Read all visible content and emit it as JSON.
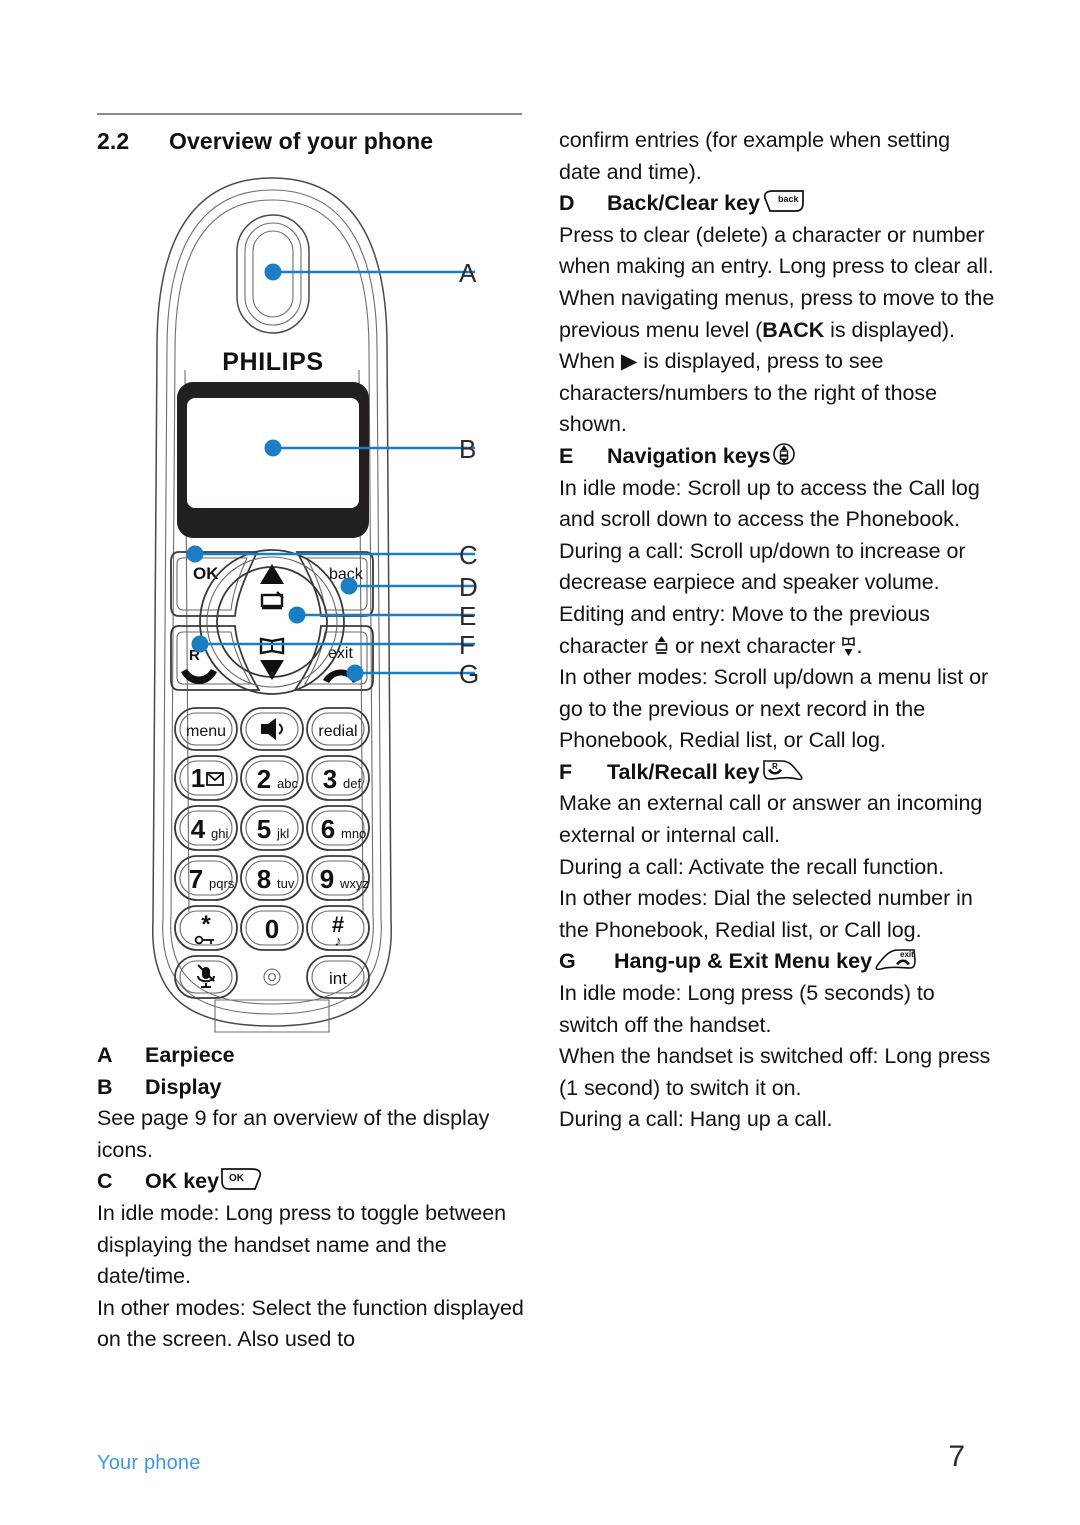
{
  "section": {
    "number": "2.2",
    "title": "Overview of your phone"
  },
  "footer": {
    "label": "Your phone",
    "page": "7"
  },
  "diagram": {
    "brand": "PHILIPS",
    "softkeys": {
      "ok": "OK",
      "back": "back",
      "exit": "exit",
      "recall": "R"
    },
    "keys": [
      {
        "main": "menu",
        "sub": ""
      },
      {
        "main": "speaker-icon",
        "sub": ""
      },
      {
        "main": "redial",
        "sub": ""
      },
      {
        "main": "1",
        "sub": "envelope-icon"
      },
      {
        "main": "2",
        "sub": "abc"
      },
      {
        "main": "3",
        "sub": "def"
      },
      {
        "main": "4",
        "sub": "ghi"
      },
      {
        "main": "5",
        "sub": "jkl"
      },
      {
        "main": "6",
        "sub": "mno"
      },
      {
        "main": "7",
        "sub": "pqrs"
      },
      {
        "main": "8",
        "sub": "tuv"
      },
      {
        "main": "9",
        "sub": "wxyz"
      },
      {
        "main": "*",
        "sub": "key-lock-icon"
      },
      {
        "main": "0",
        "sub": ""
      },
      {
        "main": "#",
        "sub": "ringer-icon"
      },
      {
        "main": "mute-mic-icon",
        "sub": ""
      },
      {
        "main": "charge-contact",
        "sub": ""
      },
      {
        "main": "int",
        "sub": ""
      }
    ],
    "callouts": [
      "A",
      "B",
      "C",
      "D",
      "E",
      "F",
      "G"
    ],
    "accent_color": "#1b7ec4"
  },
  "left_column": {
    "items": [
      {
        "letter": "A",
        "title": "Earpiece"
      },
      {
        "letter": "B",
        "title": "Display"
      }
    ],
    "display_note": "See page 9 for an overview of the display icons.",
    "ok": {
      "letter": "C",
      "title": "OK key",
      "icon": "ok-softkey-icon",
      "paragraphs": [
        "In idle mode: Long press to toggle between displaying the handset name and the date/time.",
        "In other modes: Select the function displayed on the screen. Also used to"
      ]
    }
  },
  "right_column": {
    "ok_continued": "confirm entries (for example when setting date and time).",
    "back": {
      "letter": "D",
      "title": "Back/Clear key",
      "icon": "back-softkey-icon",
      "paragraphs": [
        "Press to clear (delete) a character or number when making an entry. Long press to clear all.",
        "When navigating menus, press to move to the previous menu level (BACK is displayed).",
        "When ▶ is displayed, press to see characters/numbers to the right of those shown."
      ],
      "emphasis": "BACK"
    },
    "navigation": {
      "letter": "E",
      "title": "Navigation keys",
      "icon": "navigation-keys-icon",
      "paragraphs": [
        "In idle mode: Scroll up to access the Call log and scroll down to access the Phonebook.",
        "During a call: Scroll up/down to increase or decrease earpiece and speaker volume.",
        "Editing and entry: Move to the previous character ▲ or next character ▼.",
        "In other modes: Scroll up/down a menu list or go to the previous or next record in the Phonebook, Redial list, or Call log."
      ]
    },
    "talk": {
      "letter": "F",
      "title": "Talk/Recall key",
      "icon": "talk-recall-key-icon",
      "paragraphs": [
        "Make an external call or answer an incoming external or internal call.",
        "During a call: Activate the recall function.",
        "In other modes: Dial the selected number in the Phonebook, Redial list, or Call log."
      ]
    },
    "hangup": {
      "letter": "G",
      "title": "Hang-up & Exit Menu key",
      "icon": "hangup-exit-key-icon",
      "paragraphs": [
        "In idle mode: Long press (5 seconds) to switch off the handset.",
        "When the handset is switched off: Long press (1 second) to switch it on.",
        "During a call: Hang up a call."
      ]
    }
  }
}
